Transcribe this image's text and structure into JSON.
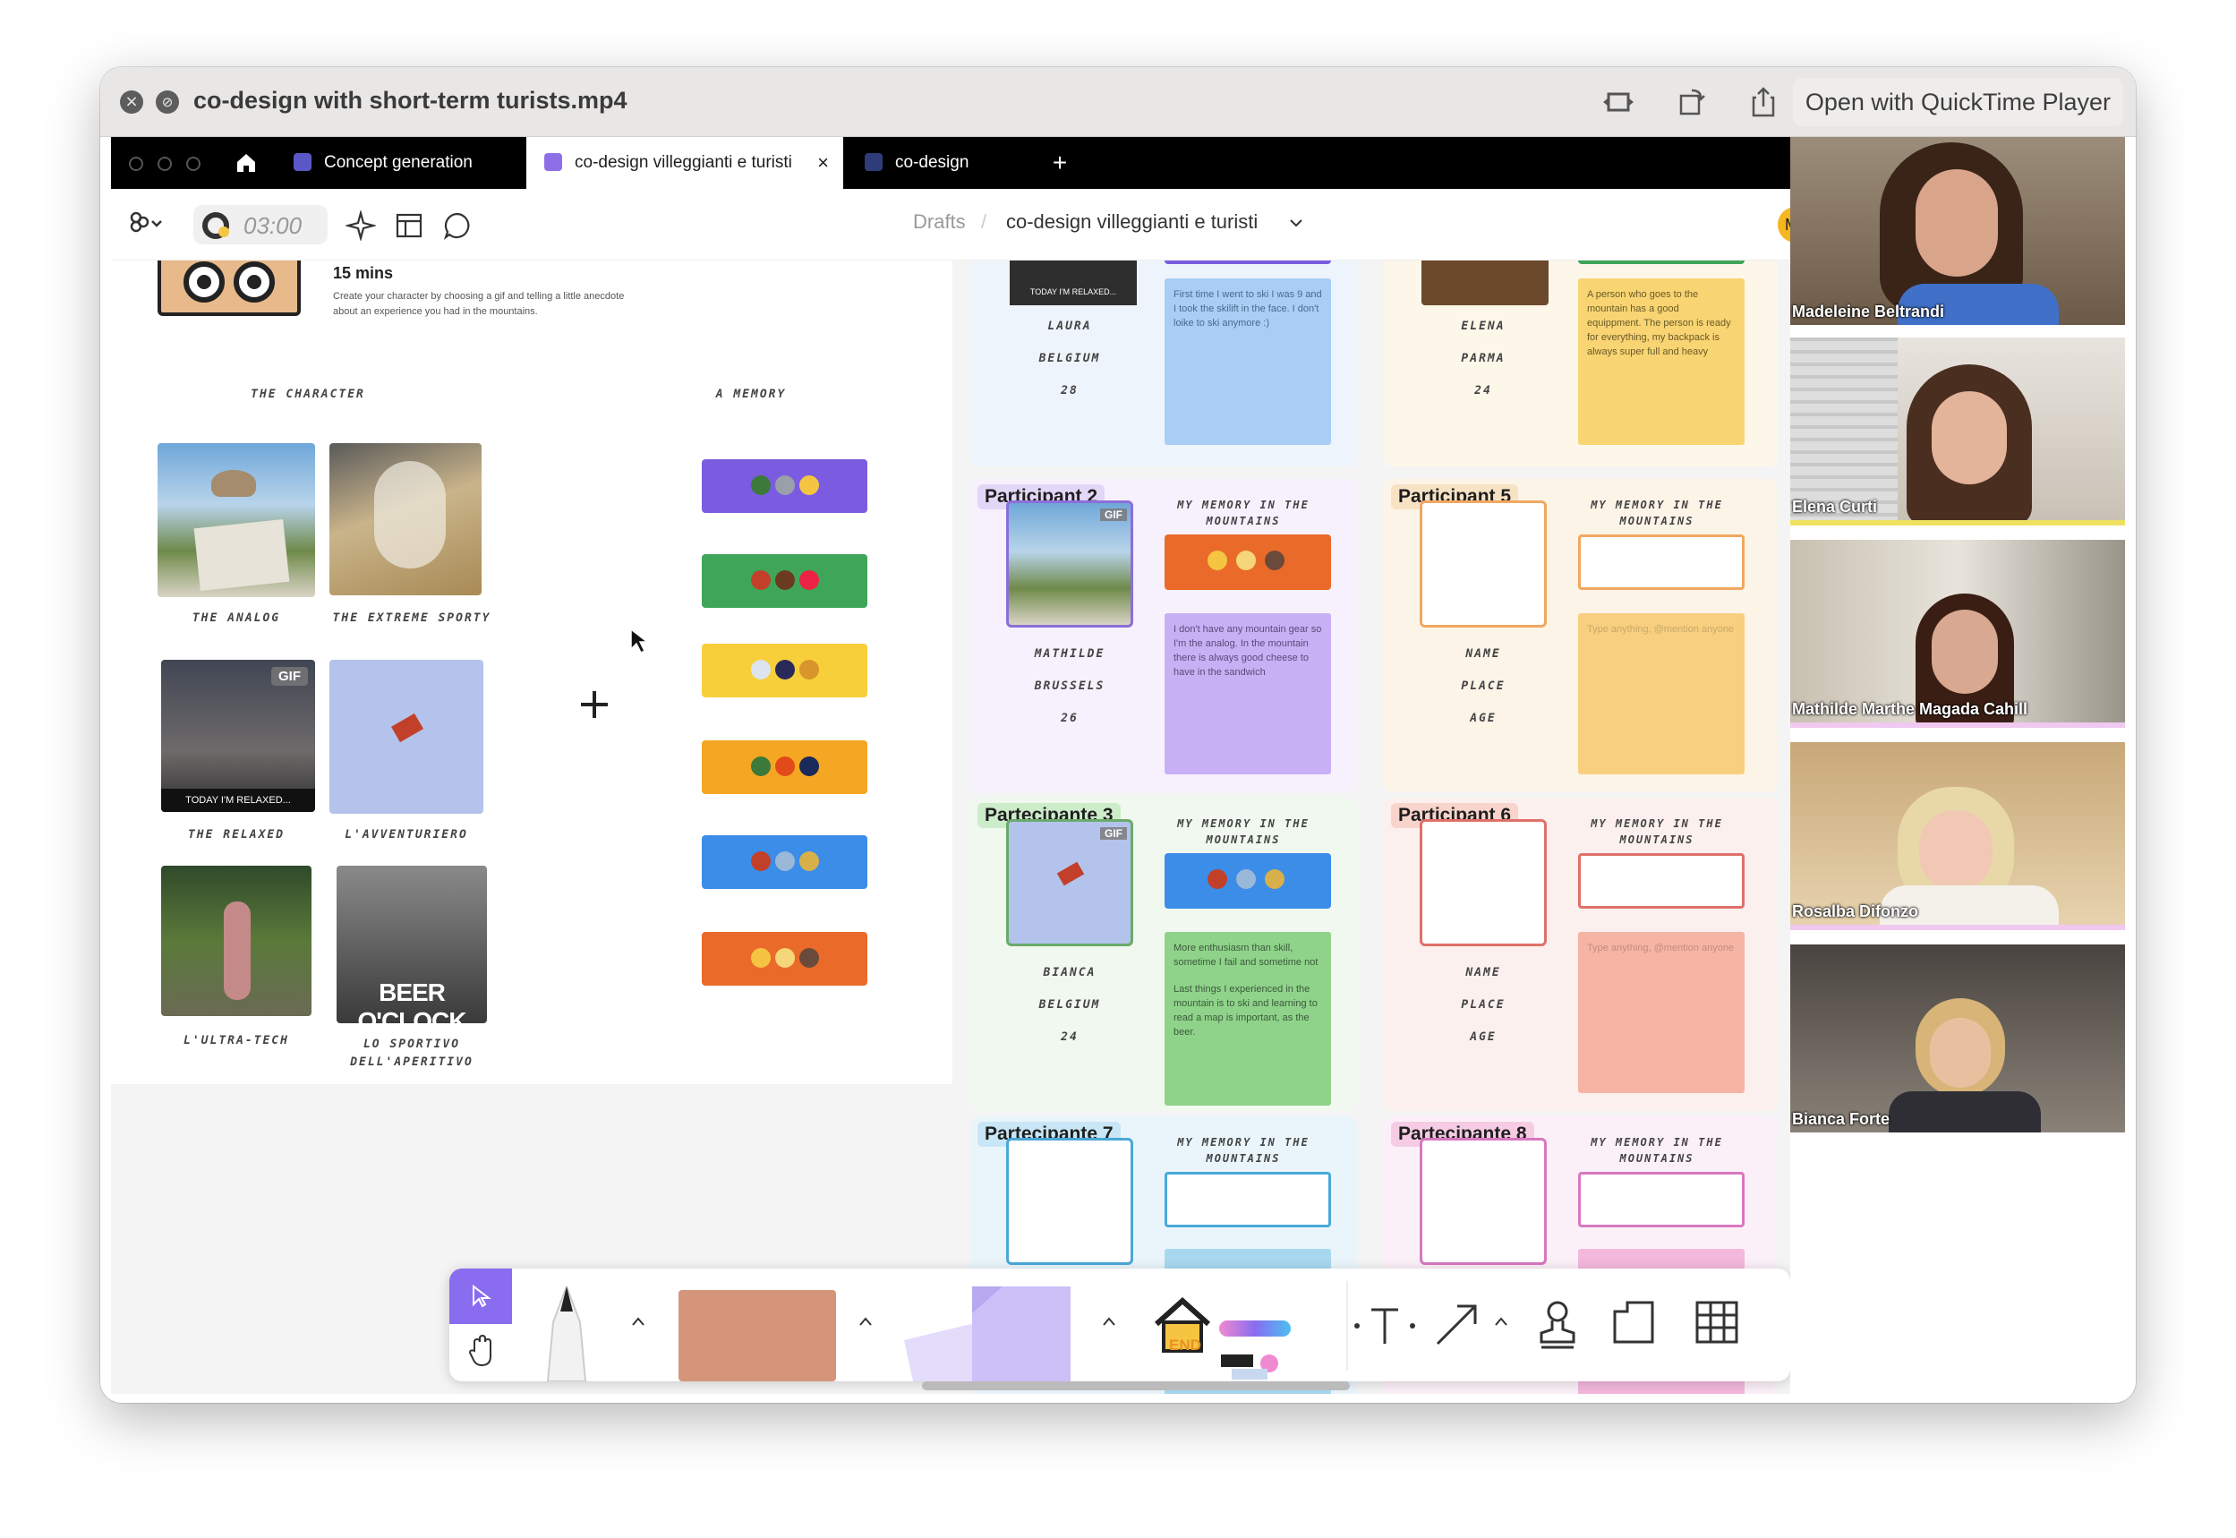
{
  "window": {
    "title": "co-design with short-term turists.mp4",
    "open_with": "Open with QuickTime Player"
  },
  "figma": {
    "tabs": [
      {
        "label": "Concept generation"
      },
      {
        "label": "co-design villeggianti e turisti"
      },
      {
        "label": "co-design"
      }
    ],
    "timer": "03:00",
    "breadcrumb": {
      "root": "Drafts",
      "separator": "/",
      "file": "co-design villeggianti e turisti"
    },
    "avatar_initial": "M"
  },
  "intro": {
    "duration": "15 mins",
    "description": "Create your character by choosing a gif and telling a little anecdote about an experience you had in the mountains."
  },
  "board": {
    "character_heading": "THE CHARACTER",
    "memory_heading": "A MEMORY",
    "characters": [
      {
        "name": "THE ANALOG"
      },
      {
        "name": "THE EXTREME SPORTY"
      },
      {
        "name": "THE RELAXED",
        "badge": "GIF",
        "caption": "TODAY I'M RELAXED..."
      },
      {
        "name": "L'AVVENTURIERO"
      },
      {
        "name": "L'ULTRA-TECH"
      },
      {
        "name": "LO SPORTIVO DELL'APERITIVO",
        "overlay": "BEER O'CLOCK"
      }
    ],
    "memory_colors": [
      "#7b5ce0",
      "#3fa659",
      "#f7cf3a",
      "#f5a623",
      "#3b8de8",
      "#ea6a2a"
    ]
  },
  "participants": [
    {
      "label": "",
      "name": "LAURA",
      "place": "BELGIUM",
      "age": "28",
      "note": "First time I went to ski I was 9 and I took the skilift in the face. I don't loike to ski anymore :)",
      "thumb_caption": "TODAY I'M RELAXED..."
    },
    {
      "label": "",
      "name": "ELENA",
      "place": "PARMA",
      "age": "24",
      "note": "A person who goes to the mountain has a good equippment. The person is ready for everything, my backpack is always super full and heavy"
    },
    {
      "label": "Participant 2",
      "memory_title": "MY MEMORY IN THE MOUNTAINS",
      "name": "MATHILDE",
      "place": "BRUSSELS",
      "age": "26",
      "note": "I don't have any mountain gear so I'm the analog. In the mountain there is always good cheese to have in the sandwich",
      "badge": "GIF"
    },
    {
      "label": "Participant 5",
      "memory_title": "MY MEMORY IN THE MOUNTAINS",
      "name": "NAME",
      "place": "PLACE",
      "age": "AGE",
      "note": "Type anything, @mention anyone"
    },
    {
      "label": "Partecipante 3",
      "memory_title": "MY MEMORY IN THE MOUNTAINS",
      "name": "BIANCA",
      "place": "BELGIUM",
      "age": "24",
      "note": "More enthusiasm than skill, sometime I fail and sometime not",
      "note2": "Last things I experienced in the mountain is to ski and learning to read a map is important, as the beer.",
      "badge": "GIF"
    },
    {
      "label": "Participant 6",
      "memory_title": "MY MEMORY IN THE MOUNTAINS",
      "name": "NAME",
      "place": "PLACE",
      "age": "AGE",
      "note": "Type anything, @mention anyone"
    },
    {
      "label": "Partecipante 7",
      "memory_title": "MY MEMORY IN THE MOUNTAINS"
    },
    {
      "label": "Partecipante 8",
      "memory_title": "MY MEMORY IN THE MOUNTAINS"
    }
  ],
  "call": {
    "people": [
      {
        "name": "Madeleine Beltrandi"
      },
      {
        "name": "Elena Curti"
      },
      {
        "name": "Mathilde Marthe Magada Cahill"
      },
      {
        "name": "Rosalba Difonzo"
      },
      {
        "name": "Bianca Forte"
      }
    ]
  },
  "bottom_toolbar": {
    "end_label": "END",
    "help": "?"
  }
}
